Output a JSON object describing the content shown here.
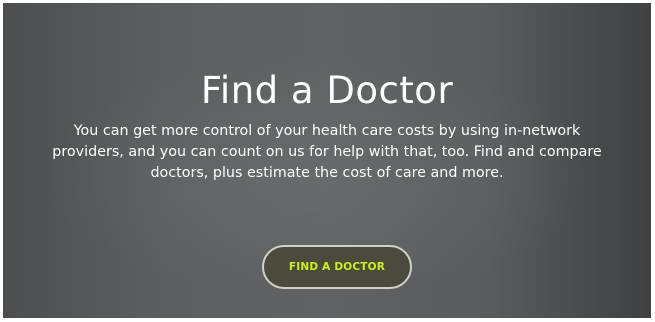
{
  "hero": {
    "title": "Find a Doctor",
    "description": "You can get more control of your health care costs by using in-network providers, and you can count on us for help with that, too. Find and compare doctors, plus estimate the cost of care and more.",
    "cta_label": "FIND A DOCTOR",
    "colors": {
      "background": "#5a5c5e",
      "text": "#ffffff",
      "cta_text": "#d4ee14",
      "cta_border": "#cfd0c8"
    }
  }
}
